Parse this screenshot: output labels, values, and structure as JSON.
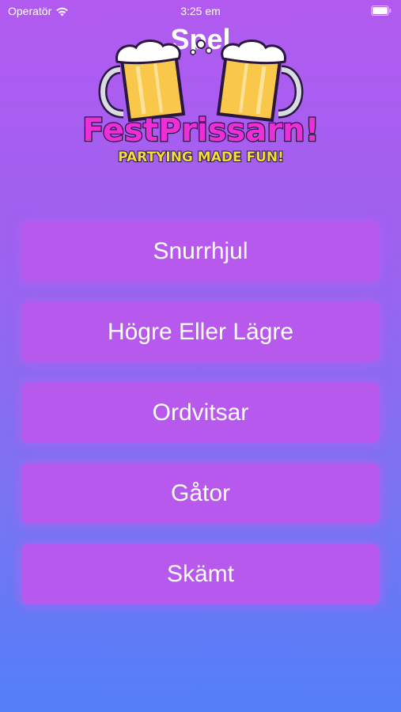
{
  "status_bar": {
    "carrier": "Operatör",
    "time": "3:25 em",
    "wifi_icon": "wifi-icon",
    "battery_icon": "battery-icon"
  },
  "header": {
    "title": "Spel"
  },
  "logo": {
    "name": "FestPrissarn!",
    "tagline": "PARTYING MADE FUN!",
    "icon": "beer-mugs-logo",
    "colors": {
      "name": "#ec2fd7",
      "tagline": "#f2dc3a",
      "beer": "#f9c74a",
      "outline": "#2a1740"
    }
  },
  "menu": {
    "buttons": [
      {
        "label": "Snurrhjul"
      },
      {
        "label": "Högre Eller Lägre"
      },
      {
        "label": "Ordvitsar"
      },
      {
        "label": "Gåtor"
      },
      {
        "label": "Skämt"
      }
    ]
  },
  "colors": {
    "background_top": "#b25af0",
    "background_bottom": "#537ff9",
    "button": "#b659ec",
    "text": "#ffffff"
  }
}
